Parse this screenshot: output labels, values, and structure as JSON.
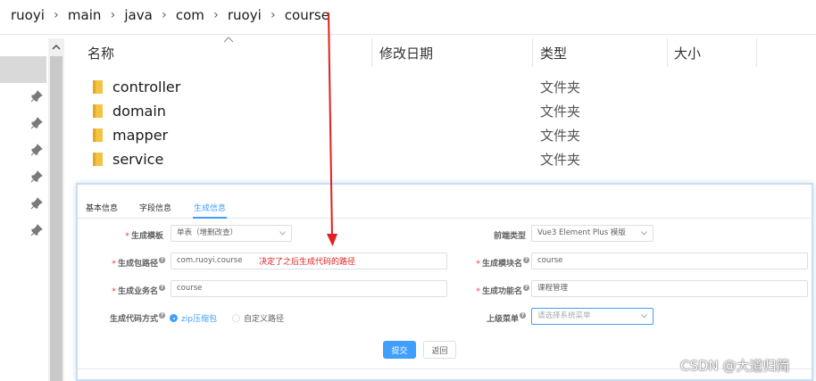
{
  "breadcrumb": [
    "ruoyi",
    "main",
    "java",
    "com",
    "ruoyi",
    "course"
  ],
  "columns": {
    "name": "名称",
    "modified": "修改日期",
    "type": "类型",
    "size": "大小"
  },
  "files": [
    {
      "name": "controller",
      "type": "文件夹"
    },
    {
      "name": "domain",
      "type": "文件夹"
    },
    {
      "name": "mapper",
      "type": "文件夹"
    },
    {
      "name": "service",
      "type": "文件夹"
    }
  ],
  "dialog": {
    "tabs": [
      "基本信息",
      "字段信息",
      "生成信息"
    ],
    "active_tab": "生成信息",
    "template_label": "生成模板",
    "template_value": "单表（增删改查）",
    "frontend_label": "前端类型",
    "frontend_value": "Vue3 Element Plus 模版",
    "package_label": "生成包路径",
    "package_value": "com.ruoyi.course",
    "annotation": "决定了之后生成代码的路径",
    "module_label": "生成模块名",
    "module_value": "course",
    "business_label": "生成业务名",
    "business_value": "course",
    "function_label": "生成功能名",
    "function_value": "课程管理",
    "gen_type_label": "生成代码方式",
    "gen_type_zip": "zip压缩包",
    "gen_type_path": "自定义路径",
    "parent_menu_label": "上级菜单",
    "parent_menu_placeholder": "请选择系统菜单",
    "submit": "提交",
    "back": "返回"
  },
  "watermark": "CSDN @大道归简",
  "colors": {
    "accent": "#409eff",
    "arrow": "#e02020",
    "required": "#f56c6c",
    "folder": "#f5c244"
  }
}
